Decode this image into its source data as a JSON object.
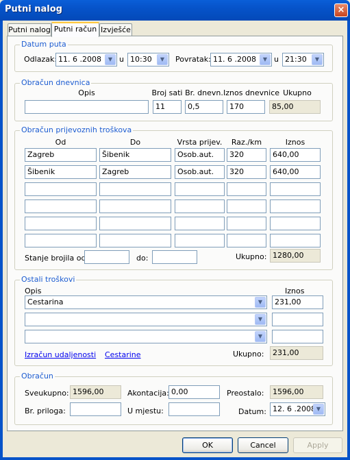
{
  "window": {
    "title": "Putni nalog",
    "close": "×"
  },
  "tabs": [
    "Putni nalog",
    "Putni račun",
    "Izvješće"
  ],
  "datum_puta": {
    "legend": "Datum puta",
    "odlazak_label": "Odlazak:",
    "odlazak_date": "11. 6 .2008",
    "u1": "u",
    "odlazak_time": "10:30",
    "povratak_label": "Povratak:",
    "povratak_date": "11. 6 .2008",
    "u2": "u",
    "povratak_time": "21:30"
  },
  "dnevnica": {
    "legend": "Obračun dnevnica",
    "h_opis": "Opis",
    "h_broj_sati": "Broj sati",
    "h_br_dnevn": "Br. dnevn.",
    "h_iznos": "Iznos dnevnice",
    "h_ukupno": "Ukupno",
    "opis": "",
    "broj_sati": "11",
    "br_dnevn": "0,5",
    "iznos": "170",
    "ukupno": "85,00"
  },
  "prijevoz": {
    "legend": "Obračun prijevoznih troškova",
    "h_od": "Od",
    "h_do": "Do",
    "h_vrsta": "Vrsta prijev.",
    "h_raz": "Raz./km",
    "h_iznos": "Iznos",
    "rows": [
      {
        "od": "Zagreb",
        "do": "Šibenik",
        "vrsta": "Osob.aut.",
        "raz": "320",
        "iznos": "640,00"
      },
      {
        "od": "Šibenik",
        "do": "Zagreb",
        "vrsta": "Osob.aut.",
        "raz": "320",
        "iznos": "640,00"
      },
      {
        "od": "",
        "do": "",
        "vrsta": "",
        "raz": "",
        "iznos": ""
      },
      {
        "od": "",
        "do": "",
        "vrsta": "",
        "raz": "",
        "iznos": ""
      },
      {
        "od": "",
        "do": "",
        "vrsta": "",
        "raz": "",
        "iznos": ""
      },
      {
        "od": "",
        "do": "",
        "vrsta": "",
        "raz": "",
        "iznos": ""
      }
    ],
    "stanje_label": "Stanje brojila od:",
    "stanje_od": "",
    "do_label": "do:",
    "stanje_do": "",
    "ukupno_label": "Ukupno:",
    "ukupno": "1280,00"
  },
  "ostali": {
    "legend": "Ostali troškovi",
    "h_opis": "Opis",
    "h_iznos": "Iznos",
    "rows": [
      {
        "opis": "Cestarina",
        "iznos": "231,00"
      },
      {
        "opis": "",
        "iznos": ""
      },
      {
        "opis": "",
        "iznos": ""
      }
    ],
    "link_udaljenosti": "Izračun udaljenosti",
    "link_cestarine": "Cestarine",
    "ukupno_label": "Ukupno:",
    "ukupno": "231,00"
  },
  "obracun": {
    "legend": "Obračun",
    "sveukupno_label": "Sveukupno:",
    "sveukupno": "1596,00",
    "akontacija_label": "Akontacija:",
    "akontacija": "0,00",
    "preostalo_label": "Preostalo:",
    "preostalo": "1596,00",
    "br_priloga_label": "Br. priloga:",
    "br_priloga": "",
    "u_mjestu_label": "U mjestu:",
    "u_mjestu": "",
    "datum_label": "Datum:",
    "datum": "12. 6 .2008"
  },
  "buttons": {
    "ok": "OK",
    "cancel": "Cancel",
    "apply": "Apply"
  }
}
